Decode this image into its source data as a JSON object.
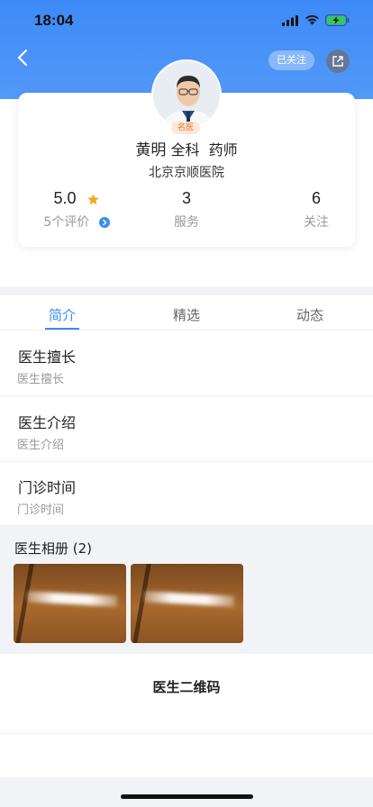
{
  "status_bar": {
    "time": "18:04"
  },
  "header": {
    "follow_label": "已关注"
  },
  "doctor": {
    "badge": "名医",
    "name": "黄明",
    "department": "全科",
    "title": "药师",
    "hospital": "北京京顺医院"
  },
  "stats": [
    {
      "value": "5.0",
      "label": "5个评价"
    },
    {
      "value": "3",
      "label": "服务"
    },
    {
      "value": "6",
      "label": "关注"
    }
  ],
  "tabs": [
    {
      "label": "简介",
      "active": true
    },
    {
      "label": "精选",
      "active": false
    },
    {
      "label": "动态",
      "active": false
    }
  ],
  "sections": [
    {
      "title": "医生擅长",
      "value": "医生擅长"
    },
    {
      "title": "医生介绍",
      "value": "医生介绍"
    },
    {
      "title": "门诊时间",
      "value": "门诊时间"
    }
  ],
  "album": {
    "title": "医生相册 (2)"
  },
  "qr": {
    "label": "医生二维码"
  },
  "colors": {
    "accent": "#3c8cf3",
    "header": "#4a91f7",
    "badge_text": "#e7742d"
  }
}
